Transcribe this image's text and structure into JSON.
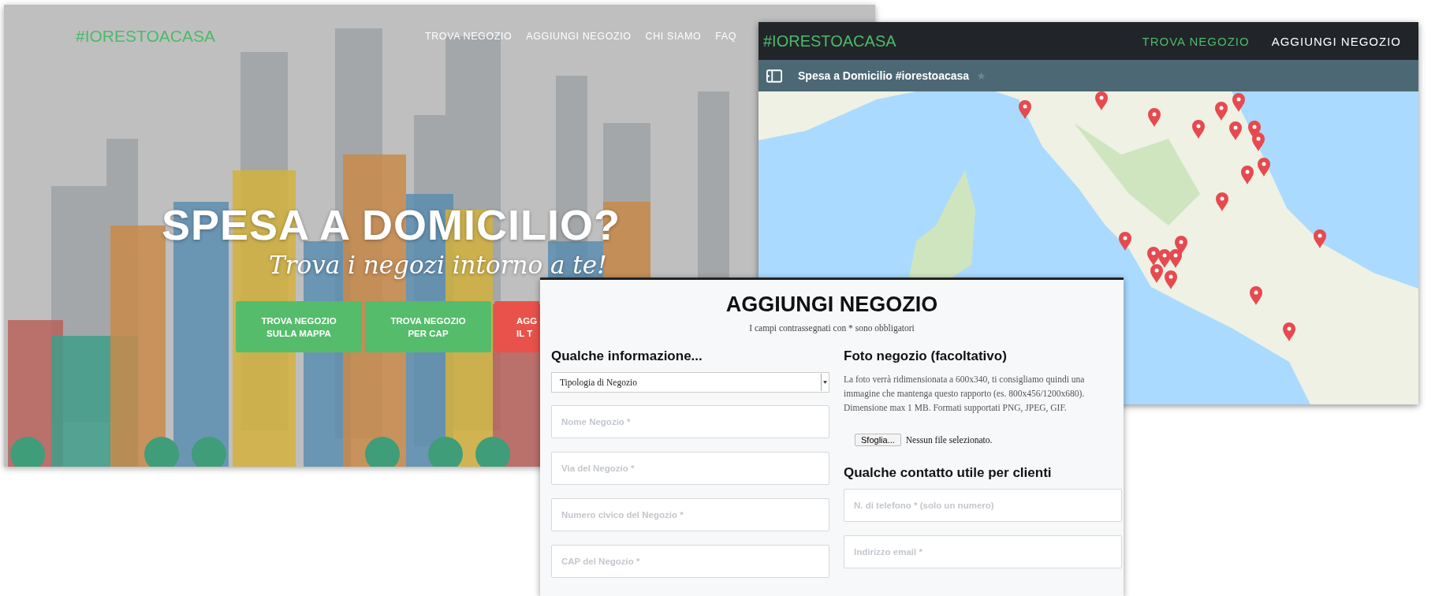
{
  "landing_page": {
    "logo": "#IORESTOACASA",
    "nav": [
      "TROVA NEGOZIO",
      "AGGIUNGI NEGOZIO",
      "CHI SIAMO",
      "FAQ"
    ],
    "headline": "SPESA A DOMICILIO?",
    "tagline": "Trova i negozi intorno a te!",
    "buttons": [
      {
        "kind": "primary",
        "lines": [
          "TROVA NEGOZIO",
          "SULLA MAPPA"
        ]
      },
      {
        "kind": "primary",
        "lines": [
          "TROVA NEGOZIO",
          "PER CAP"
        ]
      },
      {
        "kind": "danger",
        "lines": [
          "AGG",
          "IL T"
        ]
      }
    ]
  },
  "map_page": {
    "logo": "#IORESTOACASA",
    "nav": [
      {
        "label": "TROVA NEGOZIO",
        "selected": true
      },
      {
        "label": "AGGIUNGI NEGOZIO",
        "selected": false
      }
    ],
    "map_title": "Spesa a Domicilio #iorestoacasa"
  },
  "form_page": {
    "title": "AGGIUNGI NEGOZIO",
    "note": "I campi contrassegnati con * sono obbligatori",
    "left": {
      "heading": "Qualche informazione...",
      "select": {
        "value": "Tipologia di Negozio"
      },
      "fields": [
        {
          "placeholder": "Nome Negozio *"
        },
        {
          "placeholder": "Via del Negozio *"
        },
        {
          "placeholder": "Numero civico del Negozio *"
        },
        {
          "placeholder": "CAP del Negozio *"
        }
      ]
    },
    "right": {
      "photo_heading": "Foto negozio (facoltativo)",
      "photo_note": "La foto verrà ridimensionata a 600x340, ti consigliamo quindi una immagine che mantenga questo rapporto (es. 800x456/1200x680). Dimensione max 1 MB. Formati supportati PNG, JPEG, GIF.",
      "file_button": "Sfoglia...",
      "file_status": "Nessun file selezionato.",
      "contact_heading": "Qualche contatto utile per clienti",
      "fields": [
        {
          "placeholder": "N. di telefono * (solo un numero)"
        },
        {
          "placeholder": "Indirizzo email *"
        }
      ]
    }
  }
}
